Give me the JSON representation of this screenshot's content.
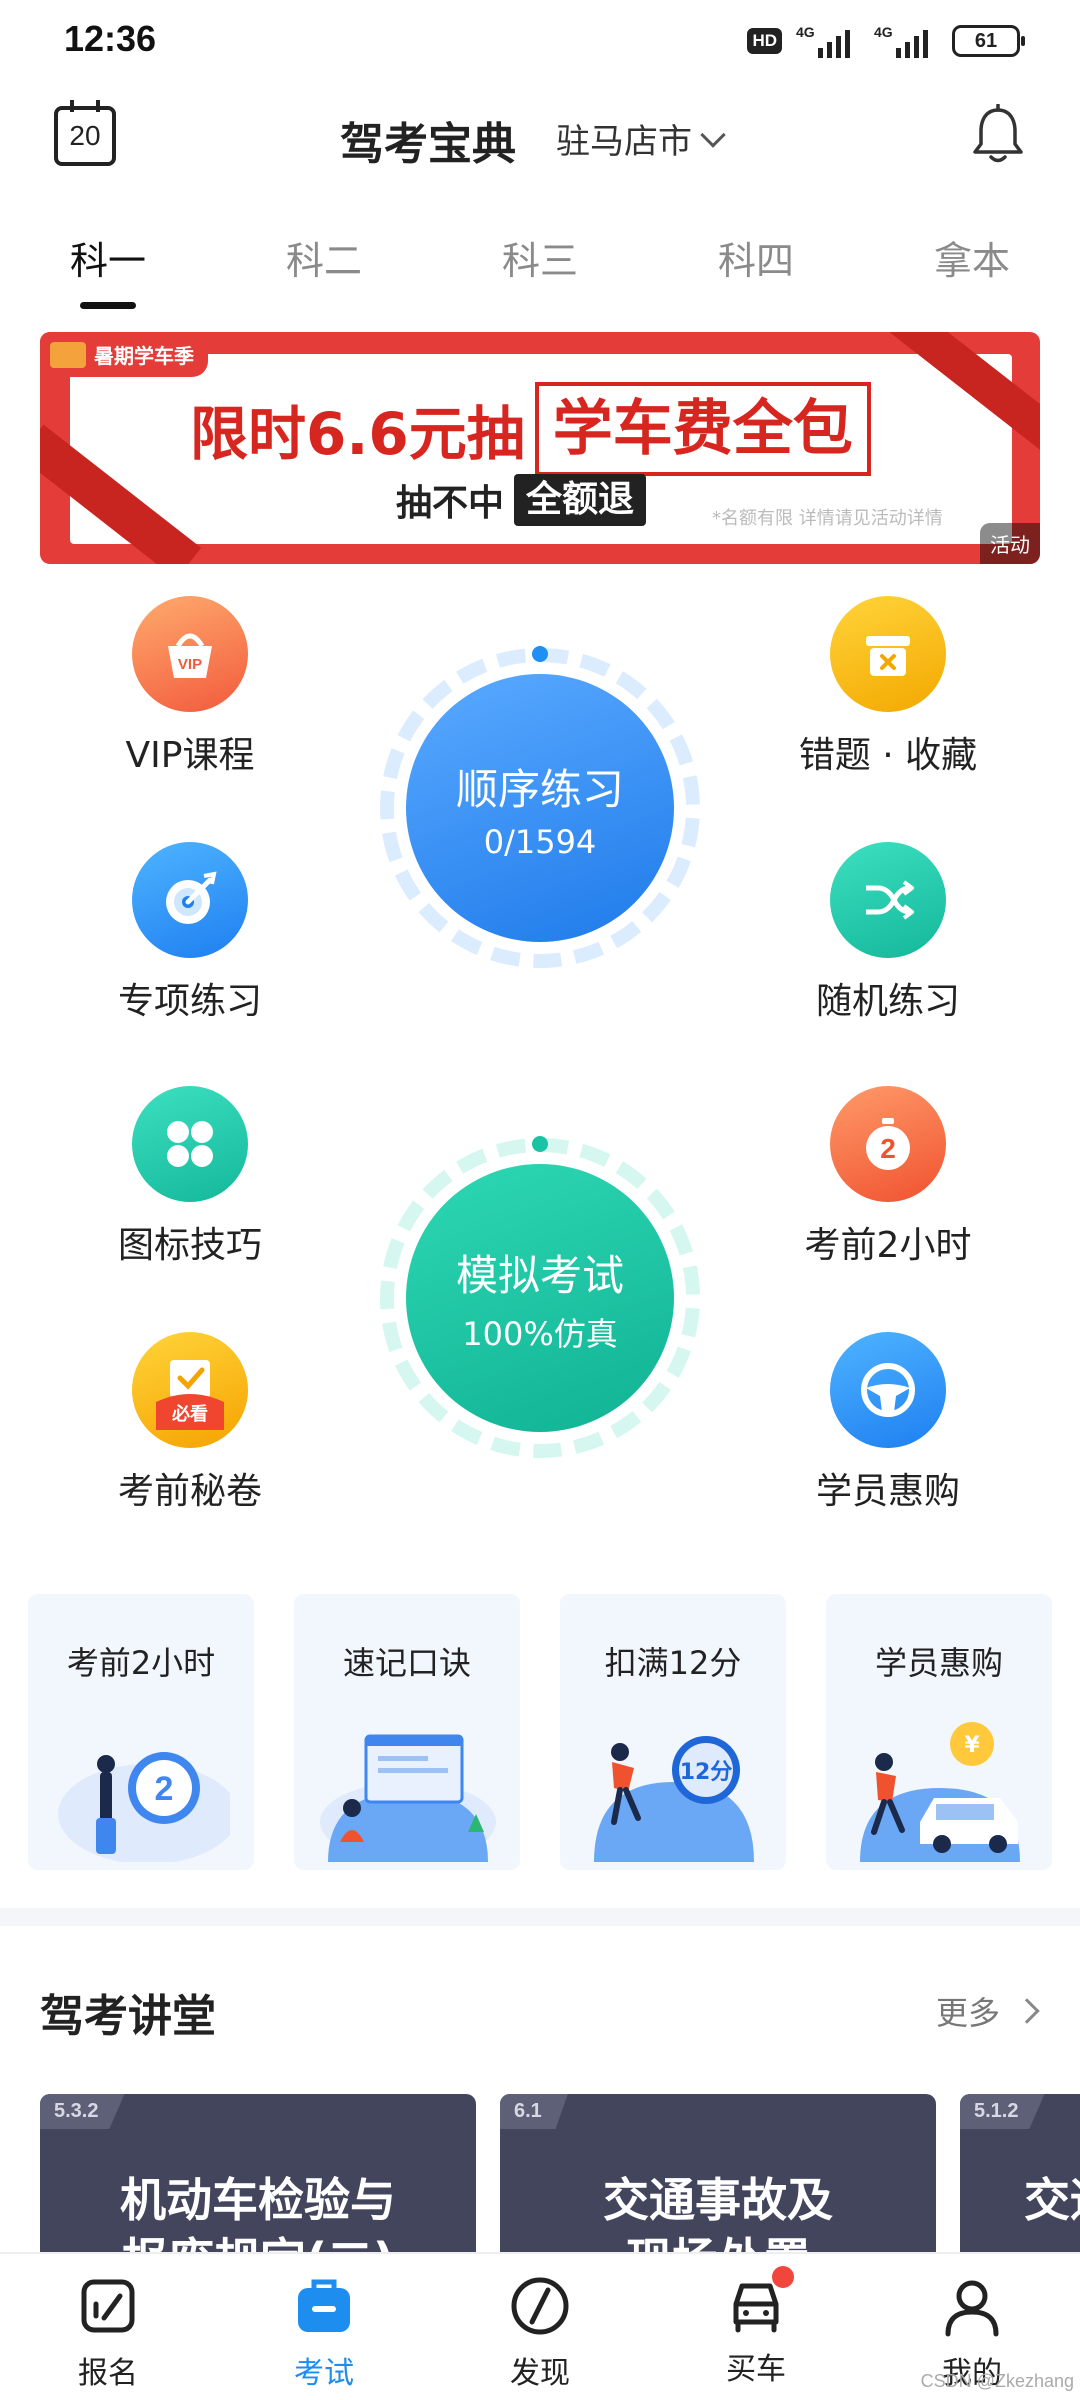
{
  "status_bar": {
    "time": "12:36",
    "hd": "HD",
    "net1": "4G",
    "net2": "4G",
    "battery": "61"
  },
  "header": {
    "date": "20",
    "title": "驾考宝典",
    "city": "驻马店市"
  },
  "tabs": [
    {
      "label": "科一",
      "active": true
    },
    {
      "label": "科二"
    },
    {
      "label": "科三"
    },
    {
      "label": "科四"
    },
    {
      "label": "拿本"
    }
  ],
  "banner": {
    "tag": "暑期学车季",
    "lead": "限时6.6元抽",
    "highlight": "学车费全包",
    "sub": "抽不中",
    "sub_highlight": "全额退",
    "note": "*名额有限 详情请见活动详情",
    "badge": "活动",
    "colors": {
      "bg": "#e33c39",
      "text": "#d7261f"
    }
  },
  "features": {
    "vip": "VIP课程",
    "wrong": "错题 · 收藏",
    "special": "专项练习",
    "random": "随机练习",
    "icon_tips": "图标技巧",
    "two_hours": "考前2小时",
    "secret": "考前秘卷",
    "purchase": "学员惠购",
    "vip_icon_text": "VIP",
    "two_icon_text": "2",
    "secret_icon_text": "必看"
  },
  "practice": {
    "title": "顺序练习",
    "progress": "0/1594",
    "color": "#2f8ff5"
  },
  "exam": {
    "title": "模拟考试",
    "subtitle": "100%仿真",
    "color": "#1cc1a1"
  },
  "cards": [
    {
      "title": "考前2小时",
      "art_text": "2"
    },
    {
      "title": "速记口诀",
      "art_text": ""
    },
    {
      "title": "扣满12分",
      "art_text": "12分"
    },
    {
      "title": "学员惠购",
      "art_text": "¥"
    }
  ],
  "lectures": {
    "title": "驾考讲堂",
    "more": "更多",
    "items": [
      {
        "badge": "5.3.2",
        "line1": "机动车检验与",
        "line2": "报废规定(二)"
      },
      {
        "badge": "6.1",
        "line1": "交通事故及",
        "line2": "现场处置"
      },
      {
        "badge": "5.1.2",
        "line1": "交通",
        "line2": ""
      }
    ]
  },
  "bottom_nav": [
    {
      "label": "报名",
      "icon": "signup-icon"
    },
    {
      "label": "考试",
      "icon": "exam-icon",
      "active": true
    },
    {
      "label": "发现",
      "icon": "discover-icon"
    },
    {
      "label": "买车",
      "icon": "car-icon"
    },
    {
      "label": "我的",
      "icon": "profile-icon"
    }
  ],
  "watermark": "CSDN @Zkezhang"
}
